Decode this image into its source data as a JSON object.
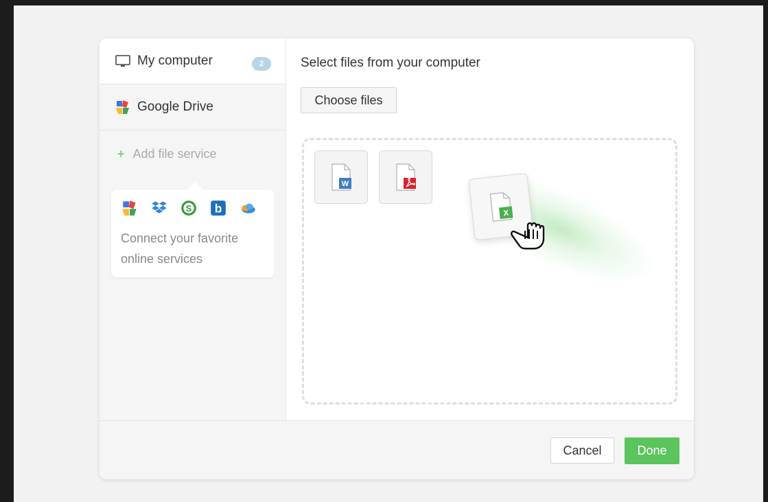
{
  "sidebar": {
    "items": [
      {
        "label": "My computer",
        "icon": "monitor-icon",
        "badge": "2"
      },
      {
        "label": "Google Drive",
        "icon": "google-drive-icon"
      }
    ],
    "add_service": {
      "label": "Add file service",
      "icon": "plus-icon"
    },
    "connect": {
      "text": "Connect your favorite online services",
      "services": [
        "google-drive-icon",
        "dropbox-icon",
        "sugarsync-icon",
        "box-icon",
        "skydrive-icon"
      ]
    }
  },
  "main": {
    "title": "Select files from your computer",
    "choose_button": "Choose files",
    "files": [
      {
        "type": "word",
        "letter": "W",
        "color": "#3f7fc1"
      },
      {
        "type": "pdf",
        "color": "#d9232e"
      },
      {
        "type": "excel",
        "letter": "X",
        "color": "#4caf50"
      }
    ]
  },
  "footer": {
    "cancel": "Cancel",
    "done": "Done"
  },
  "colors": {
    "accent_green": "#5cc45c",
    "badge_blue": "#b9d4e6"
  }
}
